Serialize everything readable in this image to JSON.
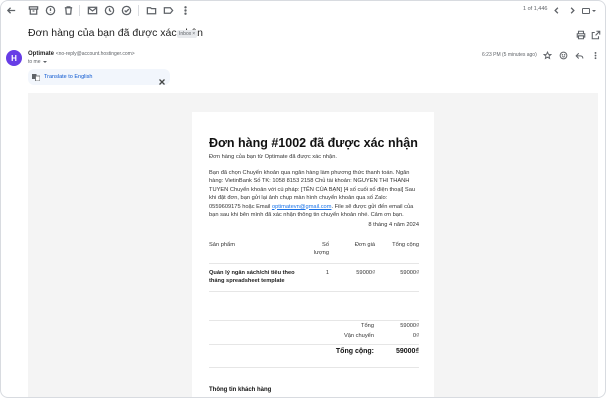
{
  "toolbar": {
    "pager": "1 of 1,446"
  },
  "email": {
    "subject": "Đơn hàng của bạn đã được xác nhận",
    "label_chip": "Inbox",
    "label_chip_close": "×",
    "avatar_letter": "H",
    "sender_name": "Optimate",
    "sender_email": "<no-reply@account.hostinger.com>",
    "to": "to me",
    "time": "6:23 PM (5 minutes ago)"
  },
  "translate": {
    "label": "Translate to English"
  },
  "body": {
    "order_title": "Đơn hàng #1002 đã được xác nhận",
    "intro": "Đơn hàng của bạn từ Optimate đã được xác nhận.",
    "payment_text": "Bạn đã chọn Chuyển khoản qua ngân hàng làm phương thức thanh toán. Ngân hàng: VietinBank Số TK: 1058 8153 2158 Chủ tài khoản: NGUYEN THI THANH TUYEN Chuyển khoản với cú pháp: [TÊN CỦA BẠN] [4 số cuối số điện thoại] Sau khi đặt đơn, bạn gửi lại ảnh chụp màn hình chuyển khoản qua số Zalo: 0559609175 hoặc Email ",
    "payment_email": "optimatevn@gmail.com",
    "payment_text_end": ". File sẽ được gửi đến email của bạn sau khi bên mình đã xác nhận thông tin chuyển khoản nhé. Cảm ơn bạn.",
    "date": "8 tháng 4 năm 2024",
    "table": {
      "headers": [
        "Sản phẩm",
        "Số lượng",
        "Đơn giá",
        "Tổng cộng"
      ],
      "rows": [
        {
          "product": "Quản lý ngân sách/chi tiêu theo tháng spreadsheet template",
          "qty": "1",
          "unit_price": "59000₫",
          "total": "59000₫"
        }
      ]
    },
    "subtotal_label": "Tổng",
    "subtotal_value": "59000₫",
    "shipping_label": "Vận chuyển",
    "shipping_value": "0₫",
    "grand_total_label": "Tổng cộng:",
    "grand_total_value": "59000₫",
    "customer_heading": "Thông tin khách hàng"
  },
  "colors": {
    "avatar": "#673de6",
    "link": "#1a73e8",
    "translate_bg": "#f2f6fc"
  }
}
